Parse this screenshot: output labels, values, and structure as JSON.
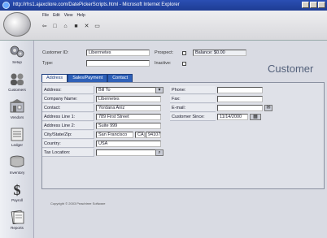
{
  "window": {
    "title": "http://rhs1.ajaxcliore.com/DatePickerScripts.html - Microsoft Internet Explorer"
  },
  "menu": {
    "items": [
      "File",
      "Edit",
      "View",
      "Help"
    ]
  },
  "sidebar": {
    "items": [
      {
        "label": "Setup",
        "icon": "gears-icon"
      },
      {
        "label": "Customers",
        "icon": "customers-icon"
      },
      {
        "label": "Vendors",
        "icon": "vendors-icon"
      },
      {
        "label": "Ledger",
        "icon": "ledger-icon"
      },
      {
        "label": "Inventory",
        "icon": "inventory-icon"
      },
      {
        "label": "Payroll",
        "icon": "dollar-icon"
      },
      {
        "label": "Reports",
        "icon": "reports-icon"
      }
    ]
  },
  "form": {
    "customer_id_label": "Customer ID:",
    "customer_id_value": "Liberrnetes",
    "type_label": "Type:",
    "type_value": "",
    "prospect_label": "Prospect:",
    "inactive_label": "Inactive:",
    "balance_text": "Balance: $0.00",
    "title": "Customer"
  },
  "tabs": [
    {
      "label": "Address",
      "active": true
    },
    {
      "label": "Sales/Payment",
      "active": false
    },
    {
      "label": "Contact",
      "active": false
    }
  ],
  "address": {
    "address_label": "Address:",
    "address_value": "Bill To",
    "company_label": "Company Name:",
    "company_value": "Libernetes",
    "contact_label": "Contact:",
    "contact_value": "Yordana Aniz",
    "line1_label": "Address Line 1:",
    "line1_value": "789 First Street",
    "line2_label": "Address Line 2:",
    "line2_value": "Suite 999",
    "csz_label": "City/State/Zip:",
    "city_value": "San Francisco",
    "state_value": "CA",
    "zip_value": "94107",
    "country_label": "Country:",
    "country_value": "USA",
    "tax_label": "Tax Location:",
    "tax_value": ""
  },
  "contactinfo": {
    "phone_label": "Phone:",
    "phone_value": "",
    "fax_label": "Fax:",
    "fax_value": "",
    "email_label": "E-mail:",
    "email_value": "",
    "since_label": "Customer Since:",
    "since_value": "11/14/2000"
  },
  "footer": {
    "copyright": "Copyright © 2003 Peachtree Software"
  }
}
